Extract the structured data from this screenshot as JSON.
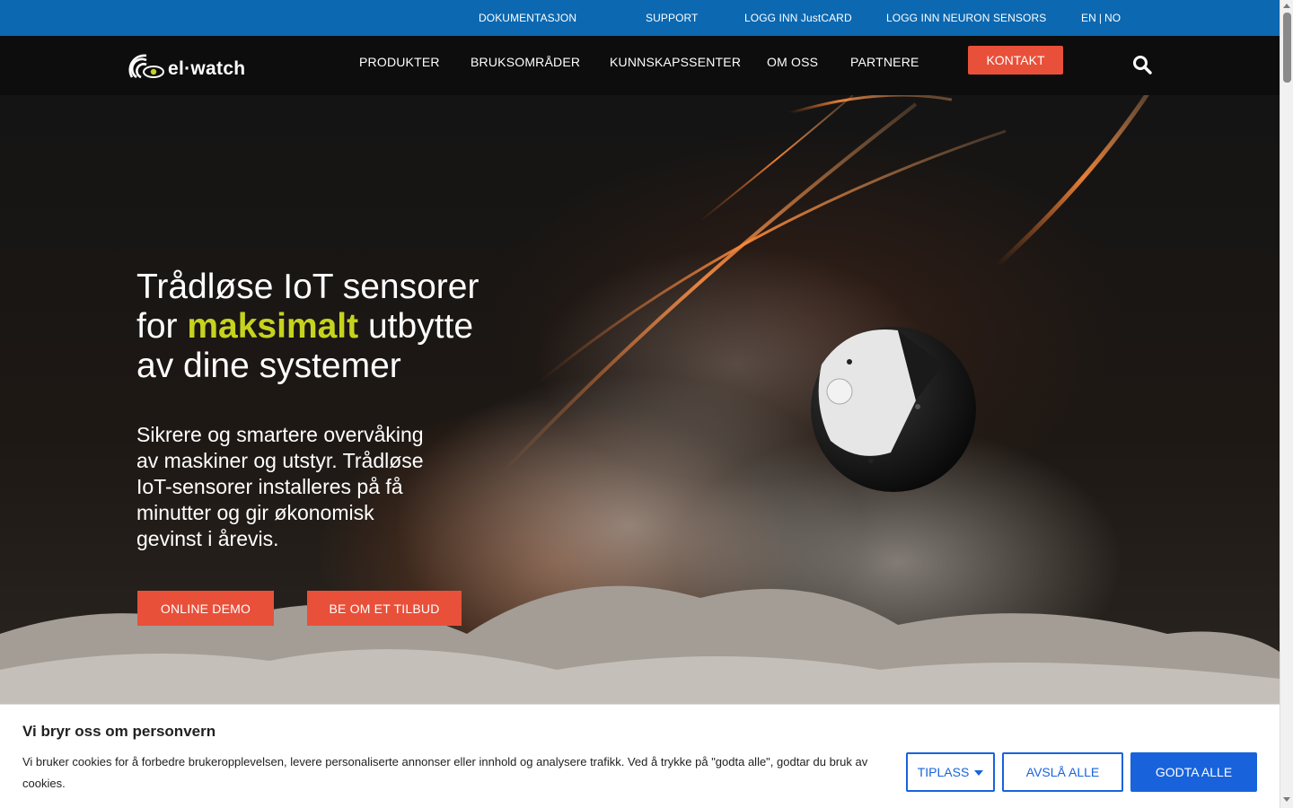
{
  "topbar": {
    "links": [
      "DOKUMENTASJON",
      "SUPPORT",
      "LOGG INN JustCARD",
      "LOGG INN NEURON SENSORS"
    ],
    "lang_en": "EN",
    "lang_sep": "|",
    "lang_no": "NO",
    "bg_color": "#0b68b1"
  },
  "nav": {
    "logo_text": "el·watch",
    "items": [
      "PRODUKTER",
      "BRUKSOMRÅDER",
      "KUNNSKAPSSENTER",
      "OM OSS",
      "PARTNERE"
    ],
    "contact_label": "KONTAKT",
    "search_icon": "search-icon"
  },
  "hero": {
    "title_line1": "Trådløse IoT sensorer",
    "title_pre": "for ",
    "title_highlight": "maksimalt",
    "title_post": " utbytte",
    "title_line3": "av dine systemer",
    "subtitle": "Sikrere og smartere overvåking av maskiner og utstyr. Trådløse IoT-sensorer installeres på få minutter og gir økonomisk gevinst i årevis.",
    "btn_demo": "ONLINE DEMO",
    "btn_offer": "BE OM ET TILBUD",
    "highlight_color": "#c6d31e",
    "button_color": "#e8503a"
  },
  "cookie": {
    "title": "Vi bryr oss om personvern",
    "text": "Vi bruker cookies for å forbedre brukeropplevelsen, levere personaliserte annonser eller innhold og analysere trafikk. Ved å trykke på \"godta alle\", godtar du bruk av cookies.",
    "btn_customize": "TIPLASS",
    "btn_reject": "AVSLÅ ALLE",
    "btn_accept": "GODTA ALLE",
    "accent_color": "#1863dc"
  }
}
